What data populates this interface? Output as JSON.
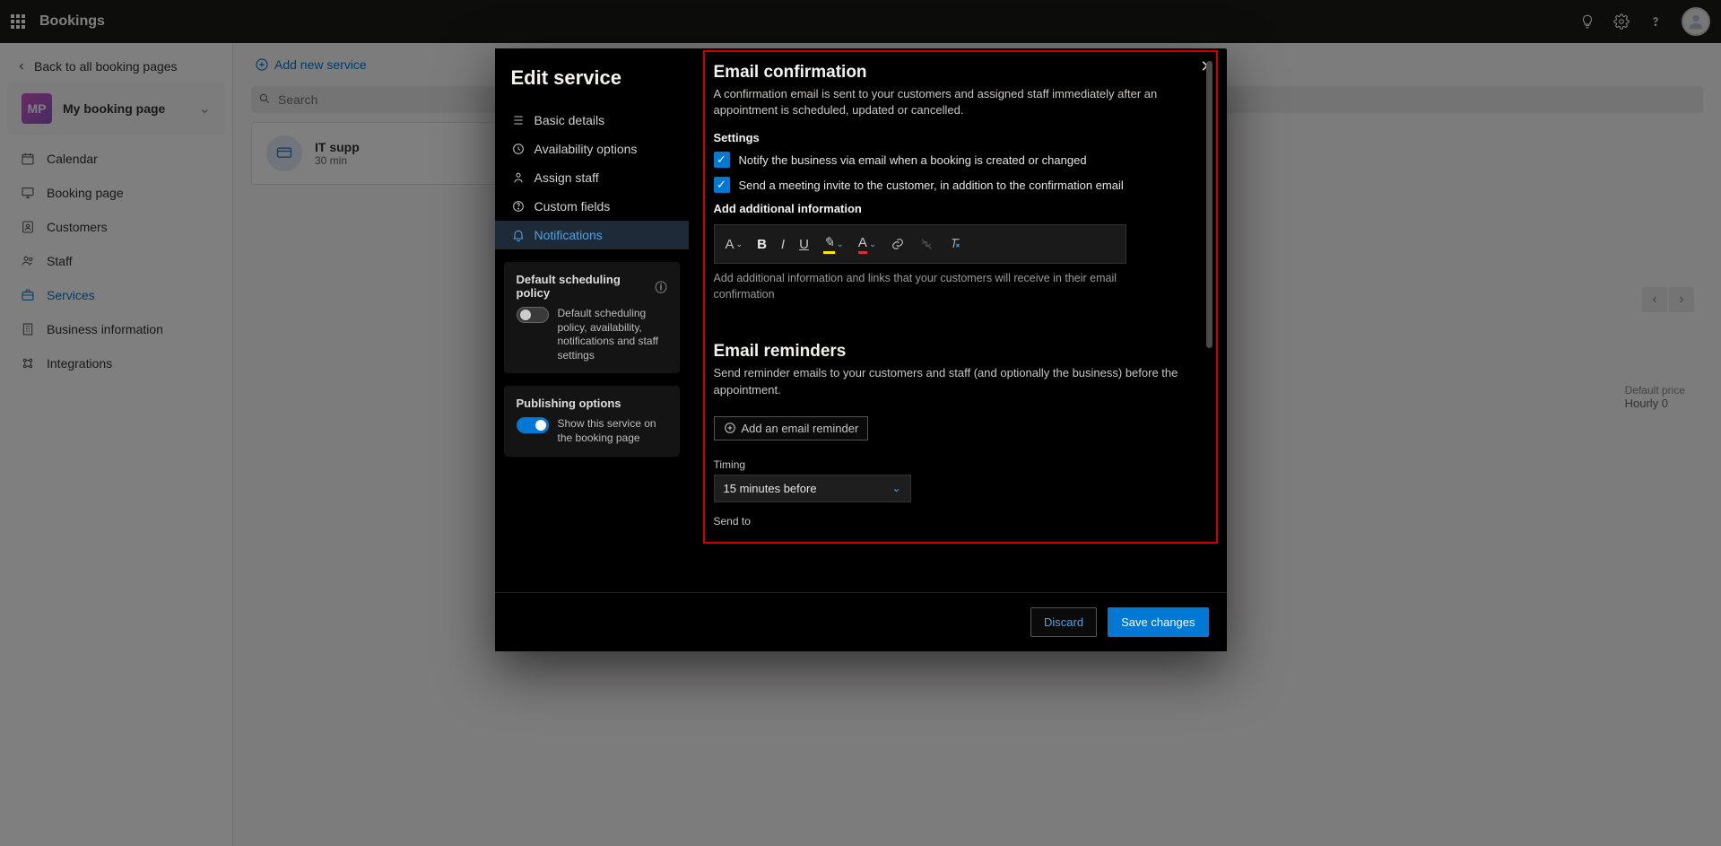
{
  "topbar": {
    "app_name": "Bookings"
  },
  "sidebar": {
    "back_link": "Back to all booking pages",
    "badge_initials": "MP",
    "badge_title": "My booking page",
    "nav": [
      {
        "label": "Calendar"
      },
      {
        "label": "Booking page"
      },
      {
        "label": "Customers"
      },
      {
        "label": "Staff"
      },
      {
        "label": "Services"
      },
      {
        "label": "Business information"
      },
      {
        "label": "Integrations"
      }
    ]
  },
  "content": {
    "add_new_service": "Add new service",
    "search_placeholder": "Search",
    "service": {
      "title": "IT supp",
      "subtitle": "30 min"
    },
    "price_label": "Default price",
    "price_value": "Hourly 0"
  },
  "modal": {
    "title": "Edit service",
    "tabs": [
      {
        "label": "Basic details"
      },
      {
        "label": "Availability options"
      },
      {
        "label": "Assign staff"
      },
      {
        "label": "Custom fields"
      },
      {
        "label": "Notifications"
      }
    ],
    "policy": {
      "title": "Default scheduling policy",
      "desc": "Default scheduling policy, availability, notifications and staff settings"
    },
    "publish": {
      "title": "Publishing options",
      "desc": "Show this service on the booking page"
    },
    "notifications": {
      "confirm_title": "Email confirmation",
      "confirm_desc": "A confirmation email is sent to your customers and assigned staff immediately after an appointment is scheduled, updated or cancelled.",
      "settings_label": "Settings",
      "check1": "Notify the business via email when a booking is created or changed",
      "check2": "Send a meeting invite to the customer, in addition to the confirmation email",
      "add_info_label": "Add additional information",
      "add_info_placeholder": "Add additional information and links that your customers will receive in their email confirmation",
      "reminders_title": "Email reminders",
      "reminders_desc": "Send reminder emails to your customers and staff (and optionally the business) before the appointment.",
      "add_reminder_btn": "Add an email reminder",
      "timing_label": "Timing",
      "timing_value": "15 minutes before",
      "sendto_label": "Send to"
    },
    "footer": {
      "discard": "Discard",
      "save": "Save changes"
    }
  }
}
